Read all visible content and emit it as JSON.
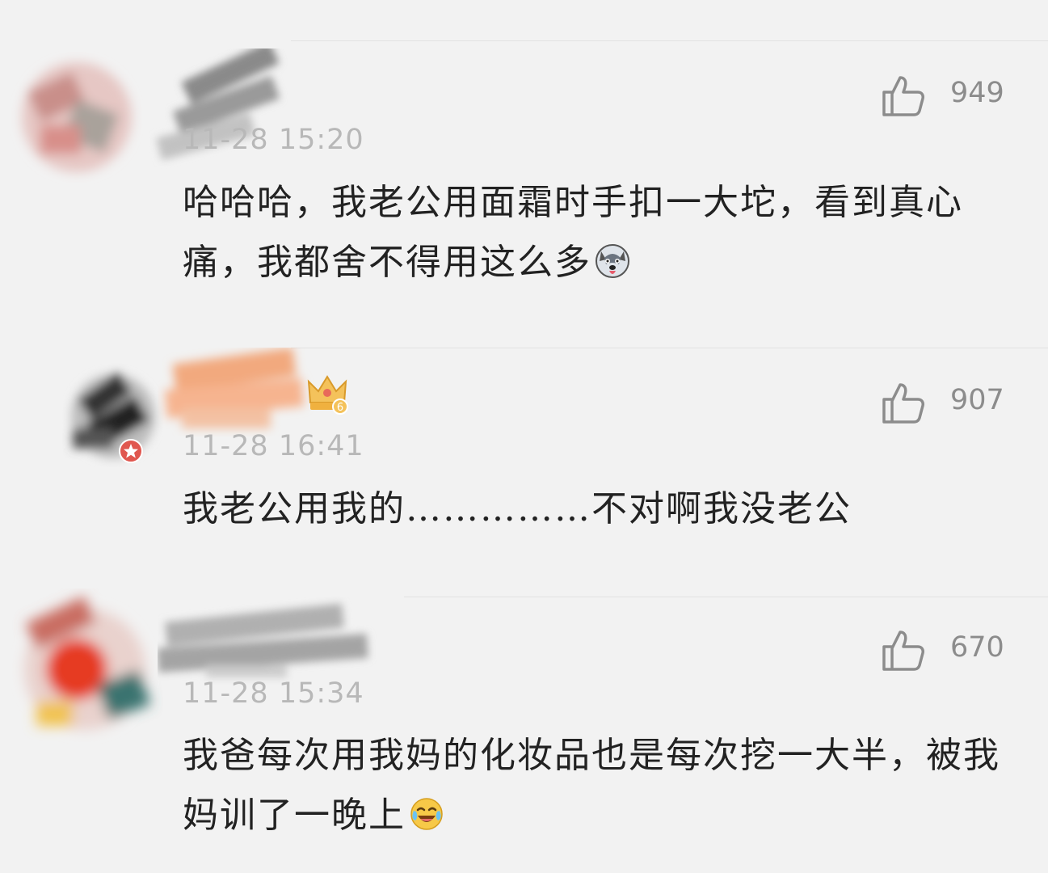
{
  "comments": [
    {
      "timestamp": "11-28 15:20",
      "likes": "949",
      "text": "哈哈哈，我老公用面霜时手扣一大坨，看到真心痛，我都舍不得用这么多",
      "emoji": "husky-emoji"
    },
    {
      "timestamp": "11-28 16:41",
      "likes": "907",
      "text": "我老公用我的……………不对啊我没老公",
      "badge": "crown-level-badge",
      "badge_level": "6"
    },
    {
      "timestamp": "11-28 15:34",
      "likes": "670",
      "text": "我爸每次用我妈的化妆品也是每次挖一大半，被我妈训了一晚上",
      "emoji": "laugh-cry-emoji"
    }
  ],
  "colors": {
    "background": "#f2f2f2",
    "text": "#222222",
    "meta": "#b8b8b8",
    "like": "#8c8c8c"
  }
}
